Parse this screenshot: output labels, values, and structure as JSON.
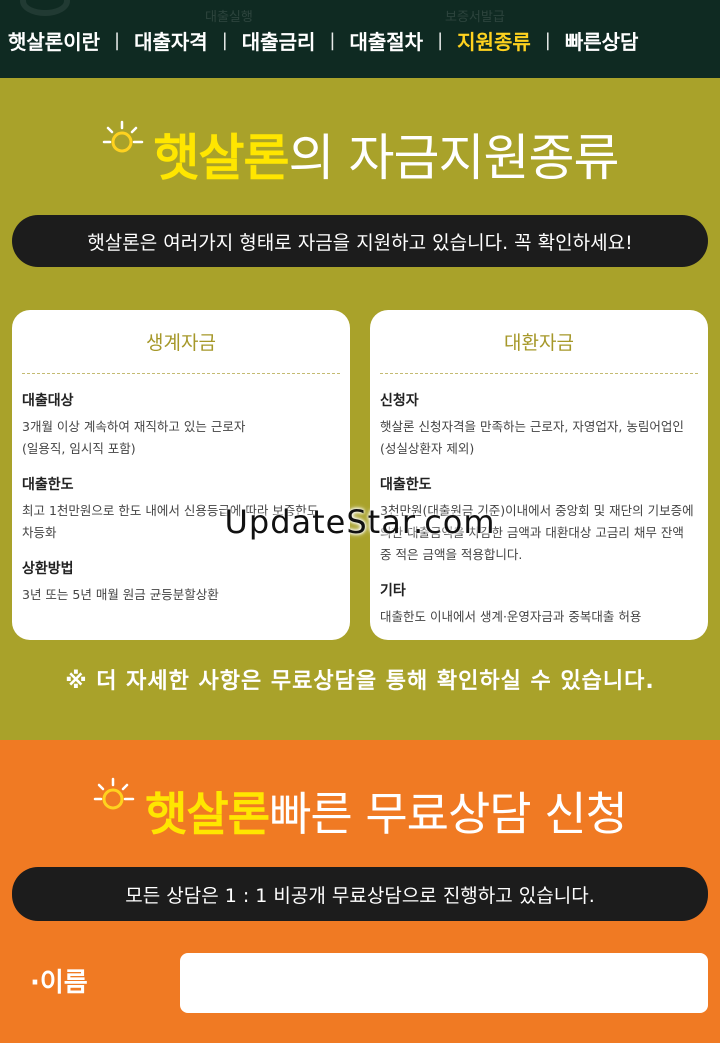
{
  "nav": {
    "ghost_left": "대출실행",
    "ghost_right": "보증서발급",
    "items": [
      {
        "label": "햇살론이란",
        "active": false
      },
      {
        "label": "대출자격",
        "active": false
      },
      {
        "label": "대출금리",
        "active": false
      },
      {
        "label": "대출절차",
        "active": false
      },
      {
        "label": "지원종류",
        "active": true
      },
      {
        "label": "빠른상담",
        "active": false
      }
    ],
    "separator": "|"
  },
  "funding": {
    "title_brand": "햇살론",
    "title_rest": "의 자금지원종류",
    "subtitle": "햇살론은 여러가지 형태로 자금을 지원하고 있습니다. 꼭 확인하세요!",
    "cards": [
      {
        "heading": "생계자금",
        "items": [
          {
            "title": "대출대상",
            "desc": "3개월 이상 계속하여 재직하고 있는 근로자\n(일용직, 임시직 포함)"
          },
          {
            "title": "대출한도",
            "desc": "최고 1천만원으로 한도 내에서 신용등급에 따라 보증한도\n차등화"
          },
          {
            "title": "상환방법",
            "desc": "3년 또는 5년 매월 원금 균등분할상환"
          }
        ]
      },
      {
        "heading": "대환자금",
        "items": [
          {
            "title": "신청자",
            "desc": "햇살론 신청자격을 만족하는 근로자, 자영업자, 농림어업인\n(성실상환자 제외)"
          },
          {
            "title": "대출한도",
            "desc": "3천만원(대출원금 기준)이내에서 중앙회 및 재단의 기보증에\n의한 대출금액을 차감한 금액과 대환대상 고금리 채무 잔액\n중 적은 금액을 적용합니다."
          },
          {
            "title": "기타",
            "desc": "대출한도 이내에서 생계·운영자금과 중복대출 허용"
          }
        ]
      }
    ],
    "note": "※ 더 자세한 사항은 무료상담을 통해 확인하실 수 있습니다."
  },
  "consult": {
    "title_brand": "햇살론",
    "title_rest": " 빠른 무료상담 신청",
    "subtitle": "모든 상담은 1 : 1 비공개 무료상담으로 진행하고 있습니다.",
    "name_label": "·이름",
    "name_value": ""
  },
  "watermark": "UpdateStar.com",
  "colors": {
    "nav_bg": "#0f2a22",
    "olive": "#a9a22a",
    "orange": "#f07a23",
    "accent_yellow": "#ffe600",
    "pill_bg": "#1c1c1c"
  },
  "icons": [
    "sun-icon"
  ]
}
